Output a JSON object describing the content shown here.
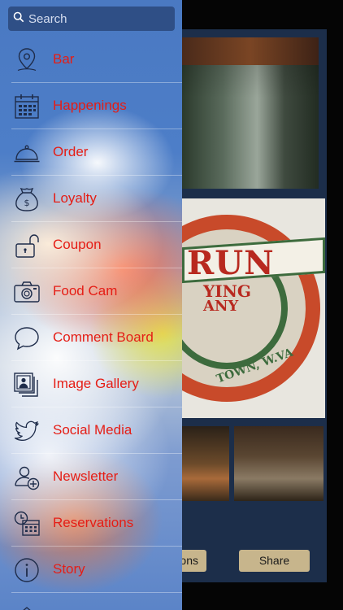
{
  "search": {
    "placeholder": "Search"
  },
  "menu": {
    "items": [
      {
        "label": "Bar",
        "icon": "map-pin-icon"
      },
      {
        "label": "Happenings",
        "icon": "calendar-icon"
      },
      {
        "label": "Order",
        "icon": "cloche-icon"
      },
      {
        "label": "Loyalty",
        "icon": "money-bag-icon"
      },
      {
        "label": "Coupon",
        "icon": "unlock-icon"
      },
      {
        "label": "Food Cam",
        "icon": "camera-icon"
      },
      {
        "label": "Comment Board",
        "icon": "speech-bubble-icon"
      },
      {
        "label": "Image Gallery",
        "icon": "photos-icon"
      },
      {
        "label": "Social Media",
        "icon": "bird-icon"
      },
      {
        "label": "Newsletter",
        "icon": "add-user-icon"
      },
      {
        "label": "Reservations",
        "icon": "clock-calendar-icon"
      },
      {
        "label": "Story",
        "icon": "info-icon"
      }
    ]
  },
  "background": {
    "logo_text": "RUN",
    "logo_line2": "YING",
    "logo_line3": "ANY",
    "logo_town": "TOWN, W.VA",
    "left_button_fragment": "ons",
    "share_label": "Share"
  },
  "colors": {
    "label": "#e51d15",
    "icon": "#1e2c4a",
    "search_bg": "#2f4f86"
  }
}
